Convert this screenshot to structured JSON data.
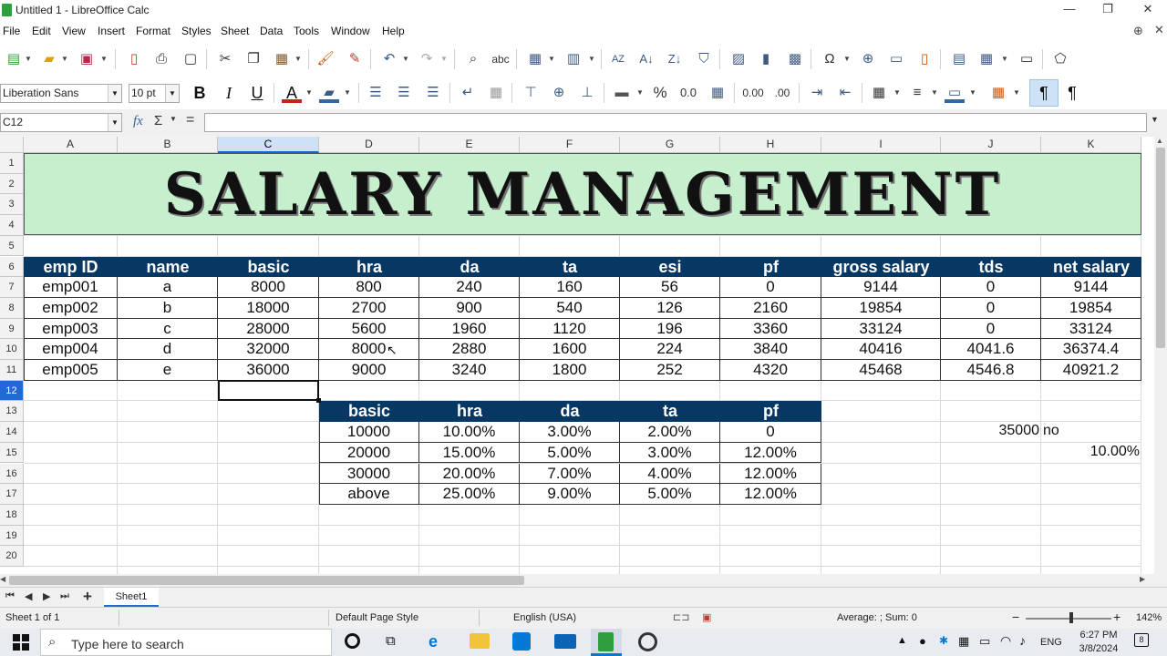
{
  "window": {
    "title": "Untitled 1 - LibreOffice Calc",
    "minimize": "—",
    "restore": "❐",
    "close": "✕"
  },
  "menu": [
    "File",
    "Edit",
    "View",
    "Insert",
    "Format",
    "Styles",
    "Sheet",
    "Data",
    "Tools",
    "Window",
    "Help"
  ],
  "formatting": {
    "font_name": "Liberation Sans",
    "font_size": "10 pt",
    "bold": "B",
    "italic": "I",
    "underline": "U",
    "font_color_glyph": "A",
    "percent": "%",
    "number_format": "0.0",
    "add_decimal": "0.00",
    "delete_decimal": ".00"
  },
  "formula_bar": {
    "cell_ref": "C12",
    "fx": "fx",
    "sigma": "Σ",
    "equals": "=",
    "content": ""
  },
  "columns": [
    "A",
    "B",
    "C",
    "D",
    "E",
    "F",
    "G",
    "H",
    "I",
    "J",
    "K"
  ],
  "rows": [
    "1",
    "2",
    "3",
    "4",
    "5",
    "6",
    "7",
    "8",
    "9",
    "10",
    "11",
    "12",
    "13",
    "14",
    "15",
    "16",
    "17",
    "18",
    "19",
    "20"
  ],
  "sheet": {
    "banner_title": "SALARY MANAGEMENT",
    "salary_headers": [
      "emp ID",
      "name",
      "basic",
      "hra",
      "da",
      "ta",
      "esi",
      "pf",
      "gross salary",
      "tds",
      "net salary"
    ],
    "salary_rows": [
      [
        "emp001",
        "a",
        "8000",
        "800",
        "240",
        "160",
        "56",
        "0",
        "9144",
        "0",
        "9144"
      ],
      [
        "emp002",
        "b",
        "18000",
        "2700",
        "900",
        "540",
        "126",
        "2160",
        "19854",
        "0",
        "19854"
      ],
      [
        "emp003",
        "c",
        "28000",
        "5600",
        "1960",
        "1120",
        "196",
        "3360",
        "33124",
        "0",
        "33124"
      ],
      [
        "emp004",
        "d",
        "32000",
        "8000",
        "2880",
        "1600",
        "224",
        "3840",
        "40416",
        "4041.6",
        "36374.4"
      ],
      [
        "emp005",
        "e",
        "36000",
        "9000",
        "3240",
        "1800",
        "252",
        "4320",
        "45468",
        "4546.8",
        "40921.2"
      ]
    ],
    "rate_headers": [
      "basic",
      "hra",
      "da",
      "ta",
      "pf"
    ],
    "rate_rows": [
      [
        "10000",
        "10.00%",
        "3.00%",
        "2.00%",
        "0"
      ],
      [
        "20000",
        "15.00%",
        "5.00%",
        "3.00%",
        "12.00%"
      ],
      [
        "30000",
        "20.00%",
        "7.00%",
        "4.00%",
        "12.00%"
      ],
      [
        "above",
        "25.00%",
        "9.00%",
        "5.00%",
        "12.00%"
      ]
    ],
    "tds_limit": "35000",
    "tds_flag": "no",
    "tds_rate": "10.00%"
  },
  "sheet_tabs": {
    "add": "+",
    "active_tab": "Sheet1"
  },
  "status": {
    "sheet_info": "Sheet 1 of 1",
    "page_style": "Default Page Style",
    "language": "English (USA)",
    "sum": "Average: ; Sum: 0",
    "zoom_minus": "−",
    "zoom_plus": "+",
    "zoom": "142%"
  },
  "taskbar": {
    "search_placeholder": "Type here to search",
    "lang": "ENG",
    "time": "6:27 PM",
    "date": "3/8/2024",
    "notifications": "8"
  },
  "colors": {
    "header_fill": "#073763",
    "banner_fill": "#c6efce",
    "selection": "#1f6ad6"
  }
}
